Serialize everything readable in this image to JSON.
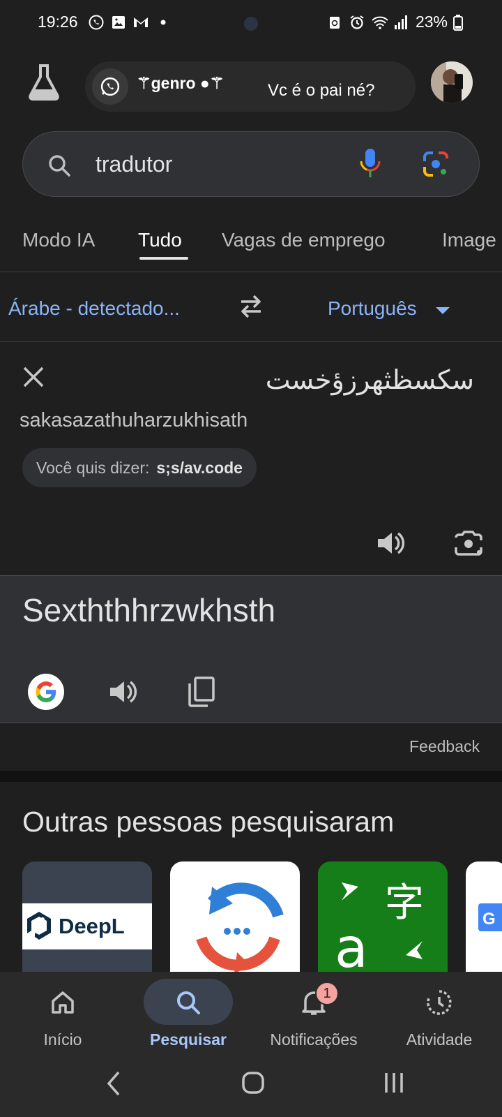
{
  "status_bar": {
    "time": "19:26",
    "battery": "23%",
    "left_icons": [
      "whatsapp-icon",
      "gallery-icon",
      "gmail-icon",
      "dot-icon"
    ],
    "right_icons": [
      "recycle-icon",
      "alarm-icon",
      "wifi-icon",
      "signal-icon",
      "battery-icon"
    ]
  },
  "header": {
    "labs_icon": "flask-icon",
    "notification": {
      "app_icon": "whatsapp-icon",
      "sender": "⚚genro ●⚚",
      "message": "Vc é o pai né?"
    }
  },
  "search": {
    "query": "tradutor",
    "icons": [
      "search-icon",
      "mic-icon",
      "lens-icon"
    ]
  },
  "tabs": [
    "Modo IA",
    "Tudo",
    "Vagas de emprego",
    "Image"
  ],
  "active_tab": "Tudo",
  "translator": {
    "source_lang": "Árabe - detectado...",
    "target_lang": "Português",
    "source_text": "سكسظثهرزؤخست",
    "transliteration": "sakasazathuharzukhisath",
    "did_you_mean_label": "Você quis dizer:",
    "did_you_mean_value": "s;s/av.code",
    "result_text": "Sexththhrzwkhsth",
    "feedback": "Feedback"
  },
  "related": {
    "title": "Outras pessoas pesquisaram",
    "cards": [
      {
        "name": "DeepL",
        "logo_text": "DeepL"
      },
      {
        "name": "translate-app-icon"
      },
      {
        "name": "microsoft-translator-icon",
        "glyph_top": "字",
        "glyph_bottom": "a"
      },
      {
        "name": "google-translate-icon",
        "glyph": "G"
      }
    ]
  },
  "bottom_nav": {
    "items": [
      {
        "label": "Início",
        "icon": "home-icon"
      },
      {
        "label": "Pesquisar",
        "icon": "search-icon"
      },
      {
        "label": "Notificações",
        "icon": "bell-icon"
      },
      {
        "label": "Atividade",
        "icon": "activity-icon"
      }
    ],
    "active": "Pesquisar",
    "notifications_badge": "1"
  },
  "colors": {
    "background": "#1f1f1f",
    "accent_blue": "#8ab4f8",
    "result_panel": "#303134",
    "nav_active": "#a8c7fa"
  }
}
